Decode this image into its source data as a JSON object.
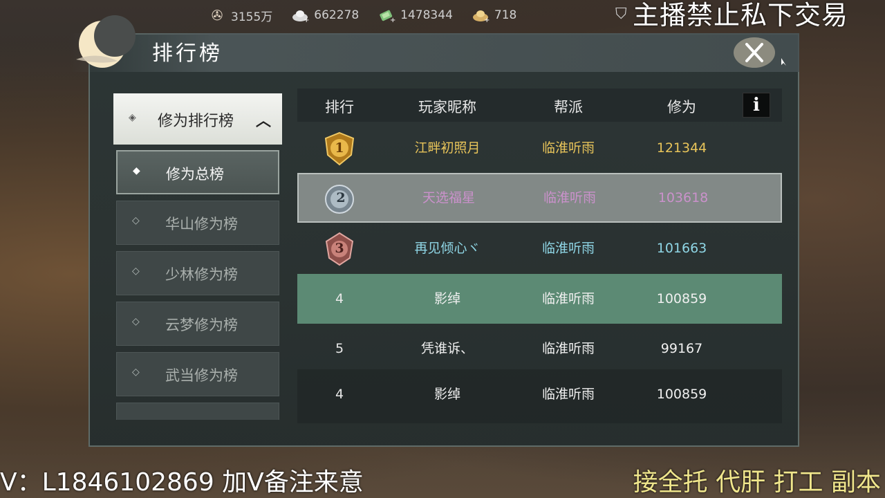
{
  "currency": [
    {
      "icon": "film-reel-icon",
      "value": "3155万"
    },
    {
      "icon": "silver-ingot-icon",
      "value": "662278"
    },
    {
      "icon": "jade-ticket-icon",
      "value": "1478344"
    },
    {
      "icon": "gold-ingot-icon",
      "value": "718"
    }
  ],
  "notice": "主播禁止私下交易",
  "window": {
    "title": "排行榜"
  },
  "sidebar": {
    "category": "修为排行榜",
    "items": [
      {
        "label": "修为总榜",
        "active": true
      },
      {
        "label": "华山修为榜",
        "active": false
      },
      {
        "label": "少林修为榜",
        "active": false
      },
      {
        "label": "云梦修为榜",
        "active": false
      },
      {
        "label": "武当修为榜",
        "active": false
      }
    ]
  },
  "table": {
    "headers": {
      "rank": "排行",
      "name": "玩家昵称",
      "guild": "帮派",
      "score": "修为"
    },
    "info_label": "i",
    "rows": [
      {
        "rank": "1",
        "name": "江畔初照月",
        "guild": "临淮听雨",
        "score": "121344",
        "color": "#e8c45a"
      },
      {
        "rank": "2",
        "name": "天选福星",
        "guild": "临淮听雨",
        "score": "103618",
        "color": "#d89ad8"
      },
      {
        "rank": "3",
        "name": "再见倾心ヾ",
        "guild": "临淮听雨",
        "score": "101663",
        "color": "#8fd6e6"
      },
      {
        "rank": "4",
        "name": "影绰",
        "guild": "临淮听雨",
        "score": "100859",
        "color": "#f0f0f0"
      },
      {
        "rank": "5",
        "name": "凭谁诉、",
        "guild": "临淮听雨",
        "score": "99167",
        "color": "#f0f0f0"
      },
      {
        "rank": "4",
        "name": "影绰",
        "guild": "临淮听雨",
        "score": "100859",
        "color": "#f0f0f0"
      }
    ]
  },
  "footer": {
    "left": "V：L1846102869 加V备注来意",
    "right": "接全托 代肝 打工 副本"
  }
}
